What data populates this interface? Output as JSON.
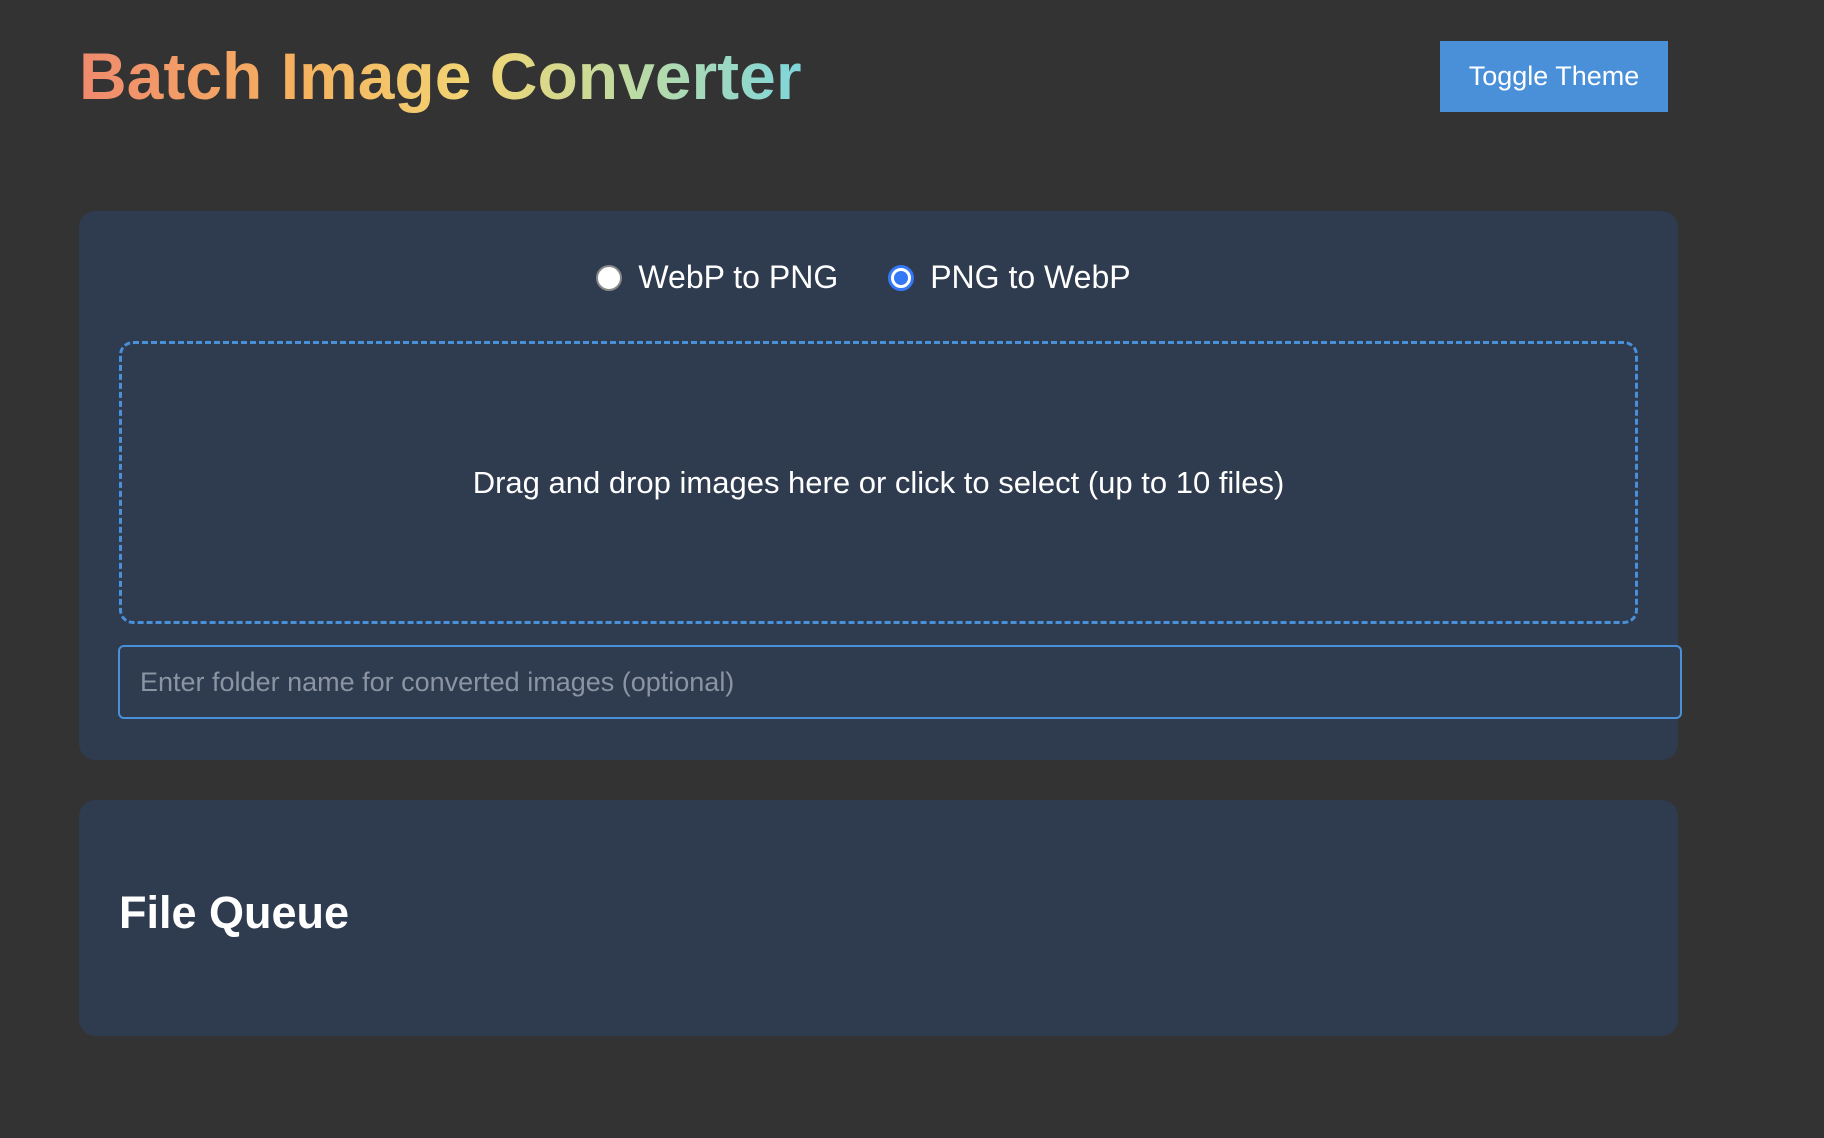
{
  "header": {
    "title": "Batch Image Converter",
    "toggle_theme_label": "Toggle Theme"
  },
  "converter": {
    "modes": [
      {
        "label": "WebP to PNG",
        "checked": false
      },
      {
        "label": "PNG to WebP",
        "checked": true
      }
    ],
    "drop_zone_text": "Drag and drop images here or click to select (up to 10 files)",
    "folder_input": {
      "value": "",
      "placeholder": "Enter folder name for converted images (optional)"
    }
  },
  "queue": {
    "title": "File Queue"
  },
  "colors": {
    "background": "#333333",
    "card": "#2f3b4e",
    "accent": "#4a90d9",
    "radio_selected": "#3478f6"
  }
}
